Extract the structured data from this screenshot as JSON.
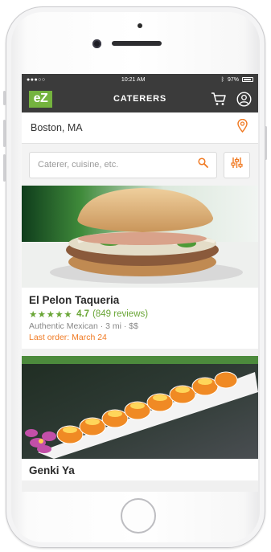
{
  "status_bar": {
    "signal": "●●●○○",
    "time": "10:21 AM",
    "battery": "97%"
  },
  "nav": {
    "logo": "eZ",
    "title": "CATERERS",
    "cart_icon": "cart-icon",
    "profile_icon": "user-icon"
  },
  "location": {
    "value": "Boston, MA",
    "icon": "location-pin-icon"
  },
  "search": {
    "placeholder": "Caterer, cuisine, etc.",
    "icon": "search-icon",
    "filter_icon": "filter-sliders-icon"
  },
  "colors": {
    "brand_green": "#74b33e",
    "accent_orange": "#f07a23",
    "nav_bg": "#3b3b3b"
  },
  "caterers": [
    {
      "name": "El Pelon Taqueria",
      "stars": "★★★★★",
      "rating": "4.7",
      "reviews": "(849 reviews)",
      "meta": "Authentic Mexican · 3 mi · $$",
      "last_order": "Last order: March 24"
    },
    {
      "name": "Genki Ya"
    }
  ]
}
